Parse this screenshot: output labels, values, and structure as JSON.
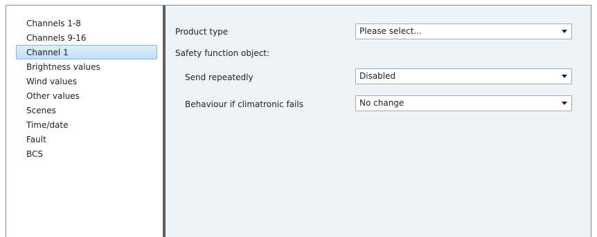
{
  "sidebar": {
    "items": [
      {
        "label": "Channels 1-8"
      },
      {
        "label": "Channels 9-16"
      },
      {
        "label": "Channel 1",
        "selected": true
      },
      {
        "label": "Brightness values"
      },
      {
        "label": "Wind values"
      },
      {
        "label": "Other values"
      },
      {
        "label": "Scenes"
      },
      {
        "label": "Time/date"
      },
      {
        "label": "Fault"
      },
      {
        "label": "BCS"
      }
    ]
  },
  "main": {
    "product_type": {
      "label": "Product type",
      "value": "Please select..."
    },
    "safety_heading": "Safety function object:",
    "send_repeatedly": {
      "label": "Send repeatedly",
      "value": "Disabled"
    },
    "behaviour": {
      "label": "Behaviour if climatronic fails",
      "value": "No change"
    }
  },
  "colors": {
    "content_bg": "#eef3fa",
    "selection_bg": "#c2e0f9",
    "splitter": "#5f5f5f"
  },
  "icons": {
    "dropdown": "chevron-down-icon"
  }
}
